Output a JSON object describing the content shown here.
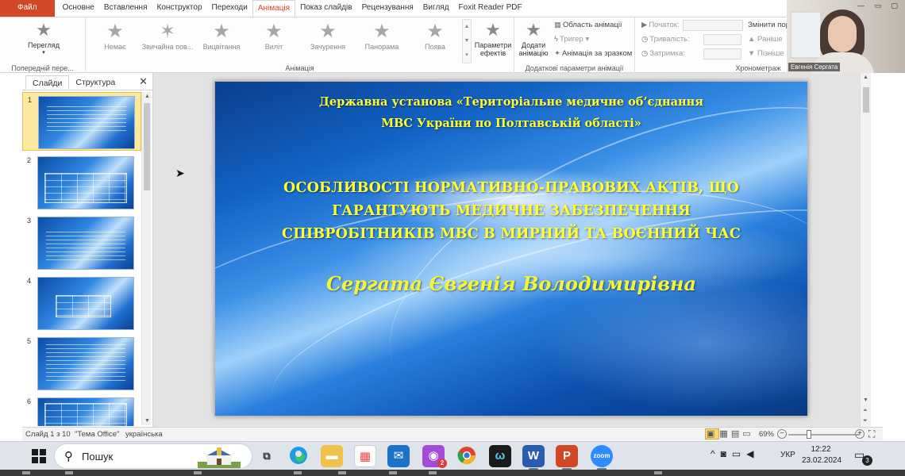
{
  "ribbon": {
    "tabs": [
      {
        "label": "Файл"
      },
      {
        "label": "Основне"
      },
      {
        "label": "Вставлення"
      },
      {
        "label": "Конструктор"
      },
      {
        "label": "Переходи"
      },
      {
        "label": "Анімація"
      },
      {
        "label": "Показ слайдів"
      },
      {
        "label": "Рецензування"
      },
      {
        "label": "Вигляд"
      },
      {
        "label": "Foxit Reader PDF"
      }
    ],
    "preview": {
      "label": "Перегляд",
      "group_label": "Попередній пере..."
    },
    "animation_group": {
      "label": "Анімація",
      "items": [
        {
          "label": "Немає"
        },
        {
          "label": "Звичайна пов..."
        },
        {
          "label": "Вицвітання"
        },
        {
          "label": "Виліт"
        },
        {
          "label": "Зачурення"
        },
        {
          "label": "Панорама"
        },
        {
          "label": "Поява"
        }
      ],
      "effects_label_1": "Параметри",
      "effects_label_2": "ефектів"
    },
    "advanced_group": {
      "label": "Додаткові параметри анімації",
      "add_label_1": "Додати",
      "add_label_2": "анімацію",
      "pane": "Область анімації",
      "trigger": "Тригер",
      "painter": "Анімація за зразком"
    },
    "timing_group": {
      "label": "Хронометраж",
      "start": "Початок:",
      "duration": "Тривалість:",
      "delay": "Затримка:",
      "reorder": "Змінити пор",
      "earlier": "Раніше",
      "later": "Пізніше"
    }
  },
  "webcam": {
    "name": "Евгенія Сергата"
  },
  "left_pane": {
    "tabs": [
      {
        "label": "Слайди"
      },
      {
        "label": "Структура"
      }
    ],
    "slides": [
      {
        "num": "1"
      },
      {
        "num": "2"
      },
      {
        "num": "3"
      },
      {
        "num": "4"
      },
      {
        "num": "5"
      },
      {
        "num": "6"
      }
    ]
  },
  "slide": {
    "institution_line1": "Державна установа «Територіальне медичне об’єднання",
    "institution_line2": "МВС України по Полтавській області»",
    "title_line1": "ОСОБЛИВОСТІ НОРМАТИВНО-ПРАВОВИХ АКТІВ, ЩО",
    "title_line2": "ГАРАНТУЮТЬ МЕДИЧНЕ ЗАБЕЗПЕЧЕННЯ",
    "title_line3": "СПІВРОБІТНИКІВ МВС В МИРНИЙ ТА ВОЄННИЙ ЧАС",
    "author": "Сергата Євгенія Володимирівна"
  },
  "status_bar": {
    "slide_info": "Слайд 1 з 10",
    "theme": "\"Тема Office\"",
    "language": "українська",
    "zoom": "69%"
  },
  "taskbar": {
    "search_label": "Пошук",
    "messenger_badge": "2",
    "word_label": "W",
    "zoom_app_label": "zoom",
    "language": "УКР",
    "time": "12:22",
    "date": "23.02.2024",
    "notifications": "3"
  },
  "colors": {
    "accent": "#d24726",
    "slide_text": "#ffff33",
    "selected_thumb": "#fbe9a2"
  }
}
